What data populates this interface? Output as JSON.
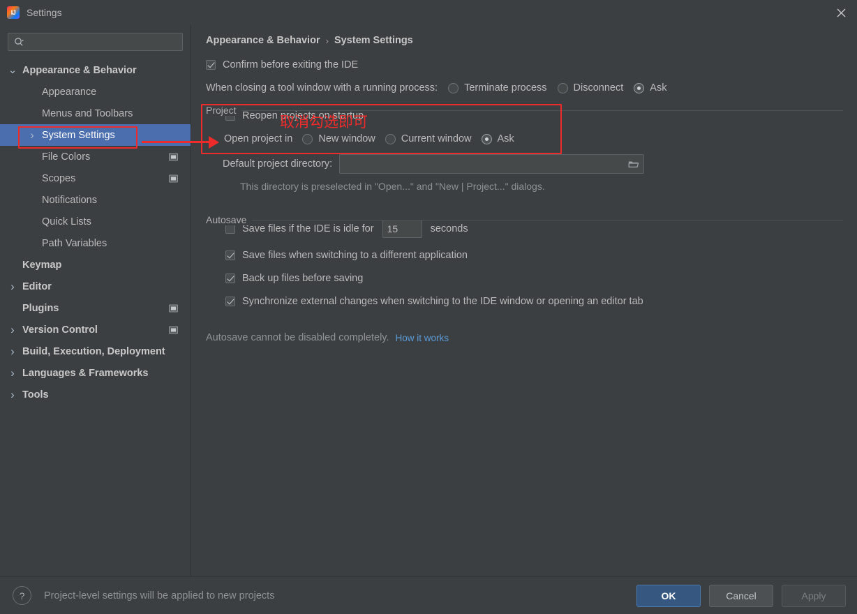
{
  "window": {
    "title": "Settings",
    "app_icon": "intellij-idea-icon",
    "close_icon": "close-icon"
  },
  "sidebar": {
    "search": {
      "placeholder": "",
      "value": "",
      "icon": "search-icon"
    },
    "items": [
      {
        "label": "Appearance & Behavior",
        "level": 0,
        "bold": true,
        "arrow": "chevron-down",
        "selected": false,
        "indicator": false
      },
      {
        "label": "Appearance",
        "level": 1,
        "bold": false,
        "arrow": "",
        "selected": false,
        "indicator": false
      },
      {
        "label": "Menus and Toolbars",
        "level": 1,
        "bold": false,
        "arrow": "",
        "selected": false,
        "indicator": false
      },
      {
        "label": "System Settings",
        "level": 1,
        "bold": false,
        "arrow": "chevron-right",
        "selected": true,
        "indicator": false
      },
      {
        "label": "File Colors",
        "level": 1,
        "bold": false,
        "arrow": "",
        "selected": false,
        "indicator": true
      },
      {
        "label": "Scopes",
        "level": 1,
        "bold": false,
        "arrow": "",
        "selected": false,
        "indicator": true
      },
      {
        "label": "Notifications",
        "level": 1,
        "bold": false,
        "arrow": "",
        "selected": false,
        "indicator": false
      },
      {
        "label": "Quick Lists",
        "level": 1,
        "bold": false,
        "arrow": "",
        "selected": false,
        "indicator": false
      },
      {
        "label": "Path Variables",
        "level": 1,
        "bold": false,
        "arrow": "",
        "selected": false,
        "indicator": false
      },
      {
        "label": "Keymap",
        "level": 0,
        "bold": true,
        "arrow": "",
        "selected": false,
        "indicator": false
      },
      {
        "label": "Editor",
        "level": 0,
        "bold": true,
        "arrow": "chevron-right",
        "selected": false,
        "indicator": false
      },
      {
        "label": "Plugins",
        "level": 0,
        "bold": true,
        "arrow": "",
        "selected": false,
        "indicator": true
      },
      {
        "label": "Version Control",
        "level": 0,
        "bold": true,
        "arrow": "chevron-right",
        "selected": false,
        "indicator": true
      },
      {
        "label": "Build, Execution, Deployment",
        "level": 0,
        "bold": true,
        "arrow": "chevron-right",
        "selected": false,
        "indicator": false
      },
      {
        "label": "Languages & Frameworks",
        "level": 0,
        "bold": true,
        "arrow": "chevron-right",
        "selected": false,
        "indicator": false
      },
      {
        "label": "Tools",
        "level": 0,
        "bold": true,
        "arrow": "chevron-right",
        "selected": false,
        "indicator": false
      }
    ]
  },
  "main": {
    "breadcrumb": {
      "parent": "Appearance & Behavior",
      "separator": "›",
      "current": "System Settings"
    },
    "confirm_exit": {
      "label": "Confirm before exiting the IDE",
      "checked": true
    },
    "closing_tool_window": {
      "label": "When closing a tool window with a running process:",
      "options": [
        {
          "label": "Terminate process",
          "selected": false
        },
        {
          "label": "Disconnect",
          "selected": false
        },
        {
          "label": "Ask",
          "selected": true
        }
      ]
    },
    "project_group": {
      "title": "Project",
      "reopen": {
        "label": "Reopen projects on startup",
        "checked": false
      },
      "open_project_in": {
        "label": "Open project in",
        "options": [
          {
            "label": "New window",
            "selected": false
          },
          {
            "label": "Current window",
            "selected": false
          },
          {
            "label": "Ask",
            "selected": true
          }
        ]
      },
      "default_dir": {
        "label": "Default project directory:",
        "value": "",
        "browse_icon": "folder-icon",
        "hint": "This directory is preselected in \"Open...\" and \"New | Project...\" dialogs."
      }
    },
    "autosave_group": {
      "title": "Autosave",
      "idle_save": {
        "label_before": "Save files if the IDE is idle for",
        "value": "15",
        "label_after": "seconds",
        "checked": false
      },
      "checkboxes": [
        {
          "label": "Save files when switching to a different application",
          "checked": true
        },
        {
          "label": "Back up files before saving",
          "checked": true
        },
        {
          "label": "Synchronize external changes when switching to the IDE window or opening an editor tab",
          "checked": true
        }
      ],
      "footnote": "Autosave cannot be disabled completely.",
      "link": "How it works"
    }
  },
  "footer": {
    "help_icon": "question-mark-icon",
    "note": "Project-level settings will be applied to new projects",
    "buttons": [
      {
        "label": "OK",
        "style": "primary"
      },
      {
        "label": "Cancel",
        "style": "normal"
      },
      {
        "label": "Apply",
        "style": "disabled"
      }
    ]
  },
  "annotations": {
    "chinese_note": "取消勾选即可",
    "color": "#ee2b2b",
    "sidebar_box_label": "System Settings",
    "arrow_target": "Reopen projects on startup"
  }
}
